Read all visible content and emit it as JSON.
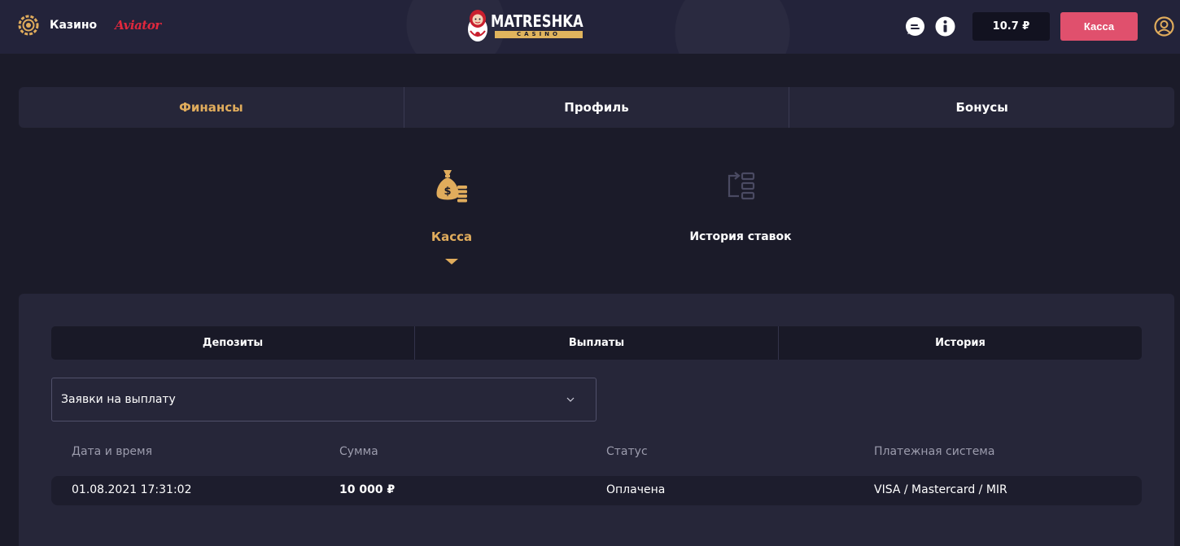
{
  "header": {
    "casino_label": "Казино",
    "aviator_label": "Aviator",
    "logo_main": "MATRESHKA",
    "logo_sub": "CASINO",
    "balance": "10.7 ₽",
    "kassa_button": "Касса"
  },
  "main_tabs": [
    {
      "label": "Финансы",
      "active": true
    },
    {
      "label": "Профиль",
      "active": false
    },
    {
      "label": "Бонусы",
      "active": false
    }
  ],
  "subnav": {
    "kassa_label": "Касса",
    "history_label": "История ставок"
  },
  "sub_tabs": [
    {
      "label": "Депозиты"
    },
    {
      "label": "Выплаты"
    },
    {
      "label": "История"
    }
  ],
  "select": {
    "value": "Заявки на выплату"
  },
  "table": {
    "headers": [
      "Дата и время",
      "Сумма",
      "Статус",
      "Платежная система"
    ],
    "rows": [
      [
        "01.08.2021 17:31:02",
        "10 000 ₽",
        "Оплачена",
        "VISA / Mastercard / MIR"
      ]
    ]
  },
  "colors": {
    "accent_gold": "#e0ac5c",
    "kassa_pink": "#e0506d",
    "aviator_red": "#e0283d",
    "background": "#1b1b29",
    "panel": "#262639"
  }
}
